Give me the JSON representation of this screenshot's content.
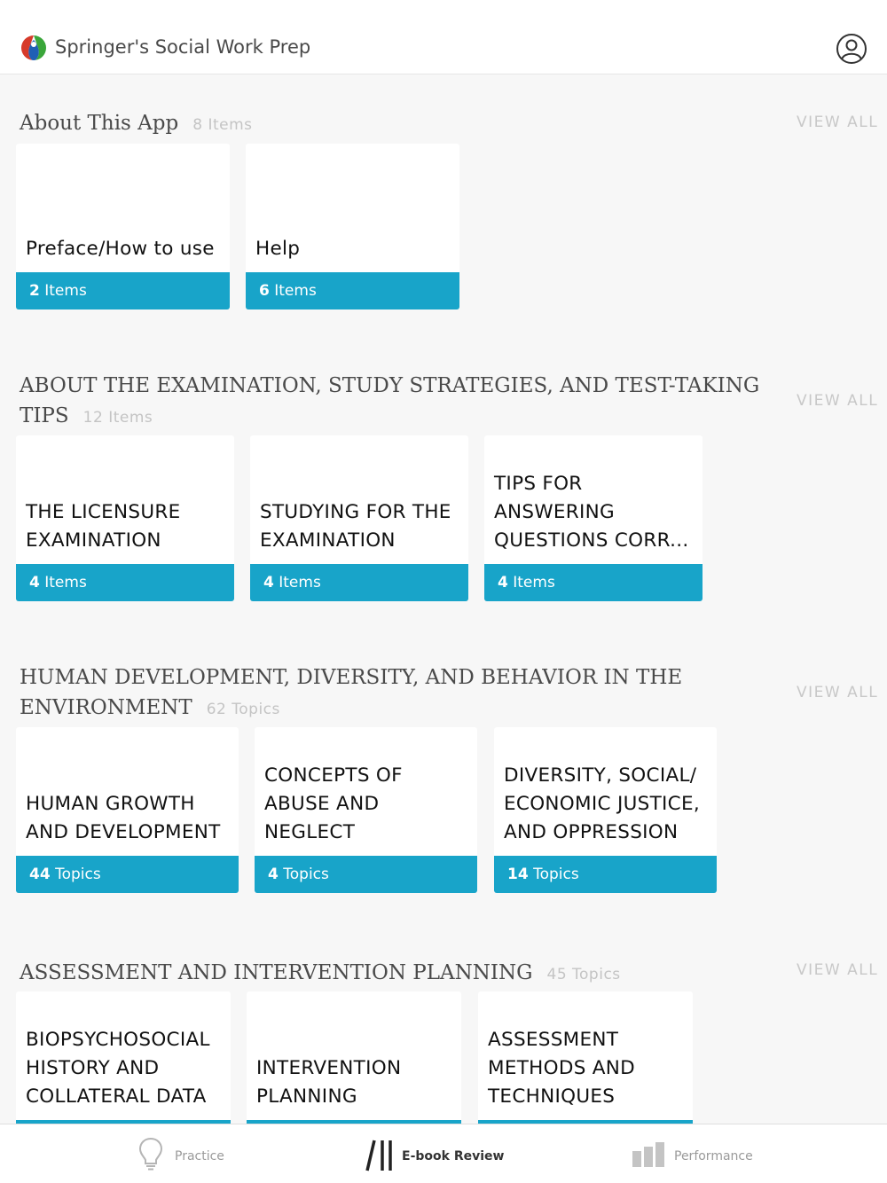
{
  "header": {
    "title": "Springer's Social Work Prep"
  },
  "sections": [
    {
      "title": "About This App",
      "count": "8 Items",
      "view_all": "VIEW ALL",
      "cards": [
        {
          "title": "Preface/How to use",
          "count_num": "2",
          "count_unit": "Items"
        },
        {
          "title": "Help",
          "count_num": "6",
          "count_unit": "Items"
        }
      ]
    },
    {
      "title": "ABOUT THE EXAMINATION, STUDY STRATEGIES, AND TEST-TAKING TIPS",
      "count": "12 Items",
      "view_all": "VIEW ALL",
      "cards": [
        {
          "title": "THE LICENSURE EXAMINATION",
          "count_num": "4",
          "count_unit": "Items"
        },
        {
          "title": "STUDYING FOR THE EXAMINATION",
          "count_num": "4",
          "count_unit": "Items"
        },
        {
          "title": "TIPS FOR ANSWERING QUESTIONS CORR...",
          "count_num": "4",
          "count_unit": "Items"
        }
      ]
    },
    {
      "title": "HUMAN DEVELOPMENT, DIVERSITY, AND BEHAVIOR IN THE ENVIRONMENT",
      "count": "62 Topics",
      "view_all": "VIEW ALL",
      "cards": [
        {
          "title": "HUMAN GROWTH AND DEVELOPMENT",
          "count_num": "44",
          "count_unit": "Topics"
        },
        {
          "title": "CONCEPTS OF ABUSE AND NEGLECT",
          "count_num": "4",
          "count_unit": "Topics"
        },
        {
          "title": "DIVERSITY, SOCIAL/ ECONOMIC JUSTICE, AND OPPRESSION",
          "count_num": "14",
          "count_unit": "Topics"
        }
      ]
    },
    {
      "title": "ASSESSMENT AND INTERVENTION PLANNING",
      "count": "45 Topics",
      "view_all": "VIEW ALL",
      "cards": [
        {
          "title": "BIOPSYCHOSOCIAL HISTORY AND COLLATERAL DATA"
        },
        {
          "title": "INTERVENTION PLANNING"
        },
        {
          "title": "ASSESSMENT METHODS AND TECHNIQUES"
        }
      ]
    }
  ],
  "tabbar": {
    "tabs": [
      {
        "label": "Practice",
        "icon": "lightbulb-icon",
        "active": false
      },
      {
        "label": "E-book Review",
        "icon": "book-stack-icon",
        "active": true
      },
      {
        "label": "Performance",
        "icon": "bar-chart-icon",
        "active": false
      }
    ]
  },
  "colors": {
    "accent": "#18a4c9",
    "background": "#f7f7f7",
    "card": "#ffffff"
  }
}
